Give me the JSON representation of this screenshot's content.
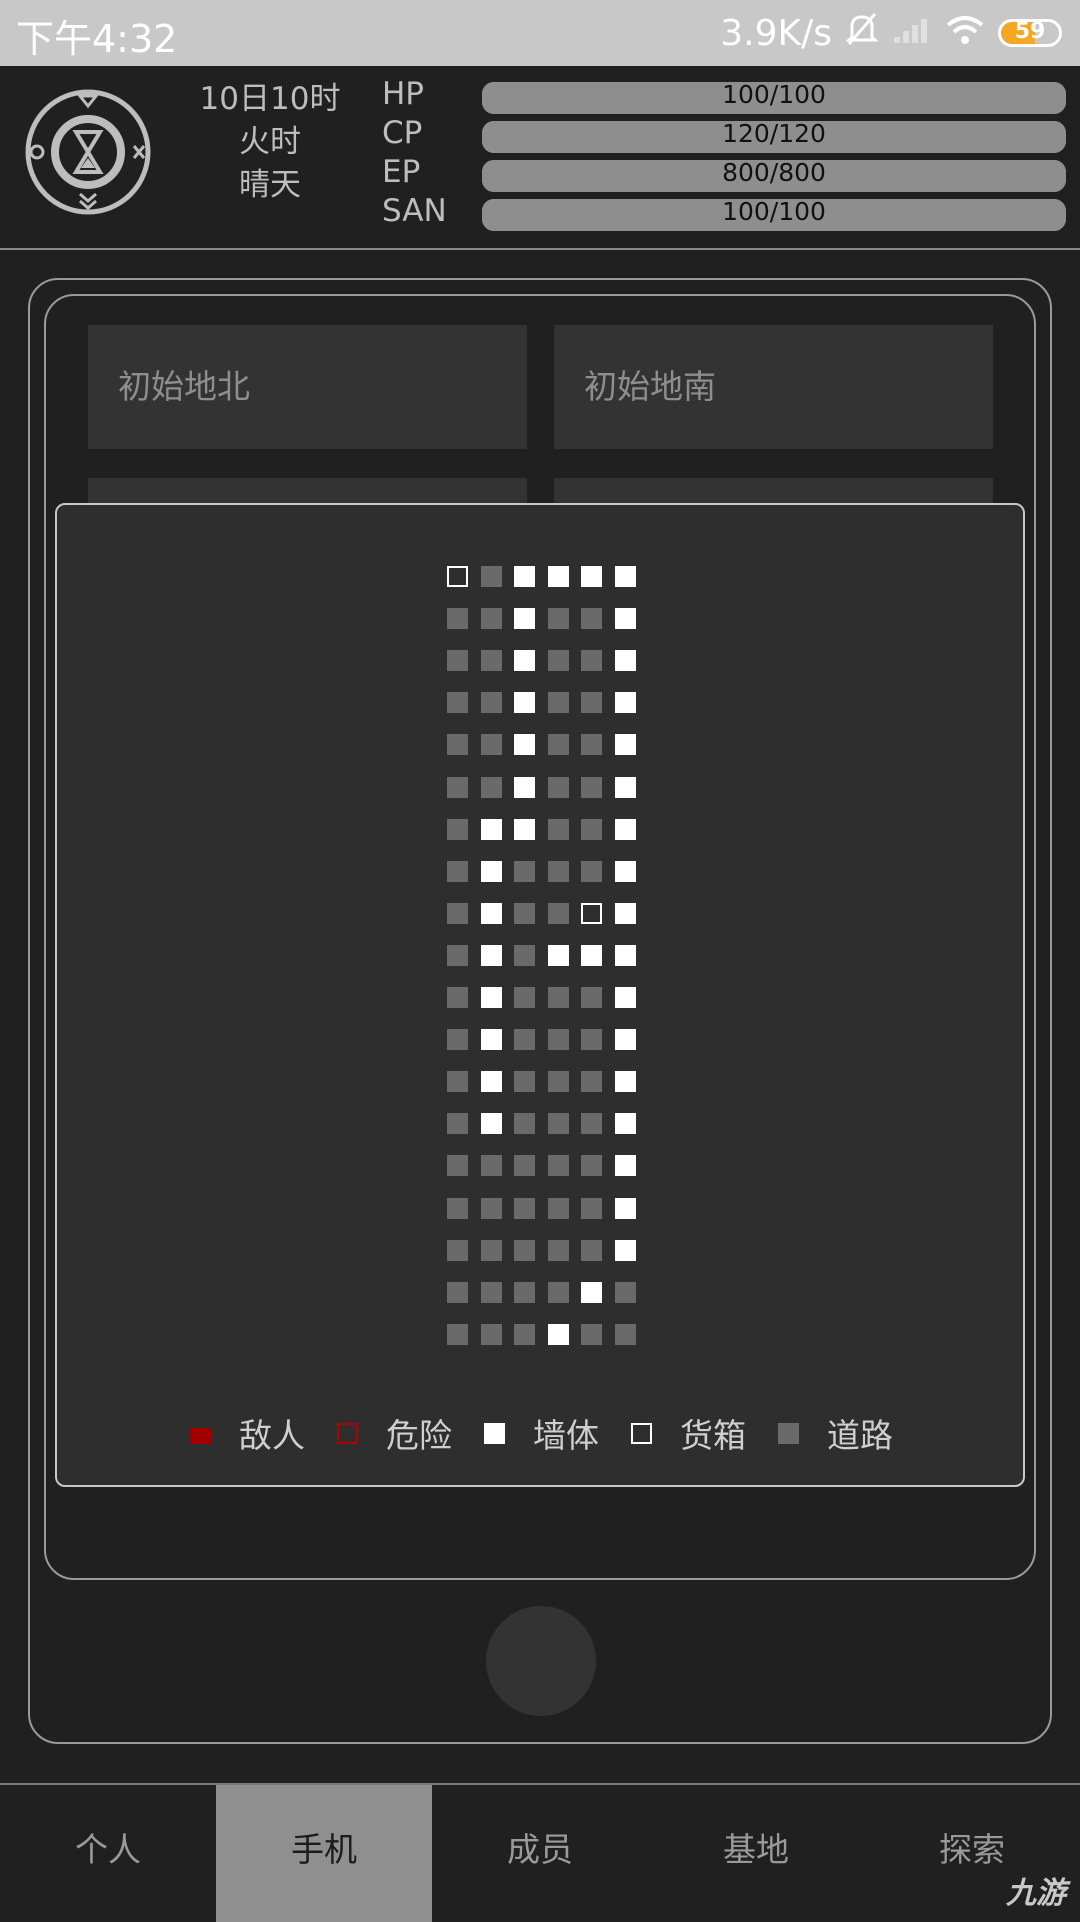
{
  "status_bar": {
    "time": "下午4:32",
    "net_speed": "3.9K/s",
    "battery_level": "59",
    "battery_percent": 59,
    "icons": [
      "mute-bell-icon",
      "signal-icon",
      "wifi-icon",
      "battery-icon"
    ]
  },
  "header": {
    "date": "10日10时",
    "period": "火时",
    "weather": "晴天",
    "stats": [
      {
        "label": "HP",
        "value": "100/100",
        "fraction": 1.0
      },
      {
        "label": "CP",
        "value": "120/120",
        "fraction": 1.0
      },
      {
        "label": "EP",
        "value": "800/800",
        "fraction": 1.0
      },
      {
        "label": "SAN",
        "value": "100/100",
        "fraction": 1.0
      }
    ],
    "logo_icon": "hourglass-compass-icon"
  },
  "locations": [
    {
      "label": "初始地北"
    },
    {
      "label": "初始地南"
    }
  ],
  "map": {
    "rows": [
      "CRWWWW",
      "RRWRRW",
      "RRWRRW",
      "RRWRRW",
      "RRWRRW",
      "RRWRRW",
      "RWWRRW",
      "RWRRRW",
      "RWRRCW",
      "RWRWWW",
      "RWRRRW",
      "RWRRRW",
      "RWRRRW",
      "RWRRRW",
      "RRRRRW",
      "RRRRRW",
      "RRRRRW",
      "RRRRWR",
      "RRRWRR"
    ],
    "legend": [
      {
        "kind": "enemy",
        "label": "敌人"
      },
      {
        "kind": "danger",
        "label": "危险"
      },
      {
        "kind": "wall",
        "label": "墙体"
      },
      {
        "kind": "crate",
        "label": "货箱"
      },
      {
        "kind": "road",
        "label": "道路"
      }
    ],
    "colors": {
      "road": "#6a6a6a",
      "wall": "#ffffff",
      "enemy": "#a00000",
      "danger": "#b00000"
    }
  },
  "nav": {
    "tabs": [
      "个人",
      "手机",
      "成员",
      "基地",
      "探索"
    ],
    "active_index": 1
  },
  "watermark": "九游"
}
